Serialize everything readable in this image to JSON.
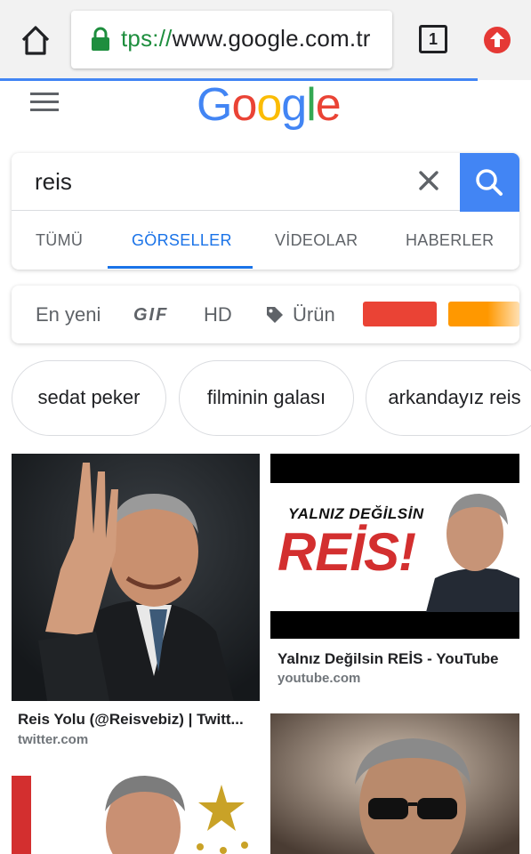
{
  "browser": {
    "url_scheme": "tps://",
    "url_host": "www.google.com.tr",
    "tab_count": "1",
    "icons": {
      "home": "home-icon",
      "lock": "lock-icon",
      "update": "update-icon"
    },
    "progress_fraction": 0.9
  },
  "header": {
    "logo_letters": [
      "G",
      "o",
      "o",
      "g",
      "l",
      "e"
    ],
    "menu_icon": "hamburger-menu-icon"
  },
  "search": {
    "query": "reis",
    "clear_icon": "close-icon",
    "search_icon": "search-icon",
    "accent_color": "#4285f4"
  },
  "tabs": [
    {
      "label": "TÜMÜ",
      "active": false
    },
    {
      "label": "GÖRSELLER",
      "active": true
    },
    {
      "label": "VİDEOLAR",
      "active": false
    },
    {
      "label": "HABERLER",
      "active": false
    }
  ],
  "filters": {
    "newest": "En yeni",
    "gif": "GIF",
    "hd": "HD",
    "product": "Ürün",
    "colors": [
      "#ea4335",
      "#ff9800"
    ]
  },
  "chips": [
    "sedat peker",
    "filminin galası",
    "arkandayız reis"
  ],
  "results": [
    {
      "title": "Reis Yolu (@Reisvebiz) | Twitt...",
      "source": "twitter.com"
    },
    {
      "title": "Yalnız Değilsin REİS - YouTube",
      "source": "youtube.com",
      "banner_top": "YALNIZ DEĞİLSİN",
      "banner_main": "REİS!"
    },
    {
      "title": "",
      "source": ""
    },
    {
      "title": "",
      "source": ""
    }
  ]
}
